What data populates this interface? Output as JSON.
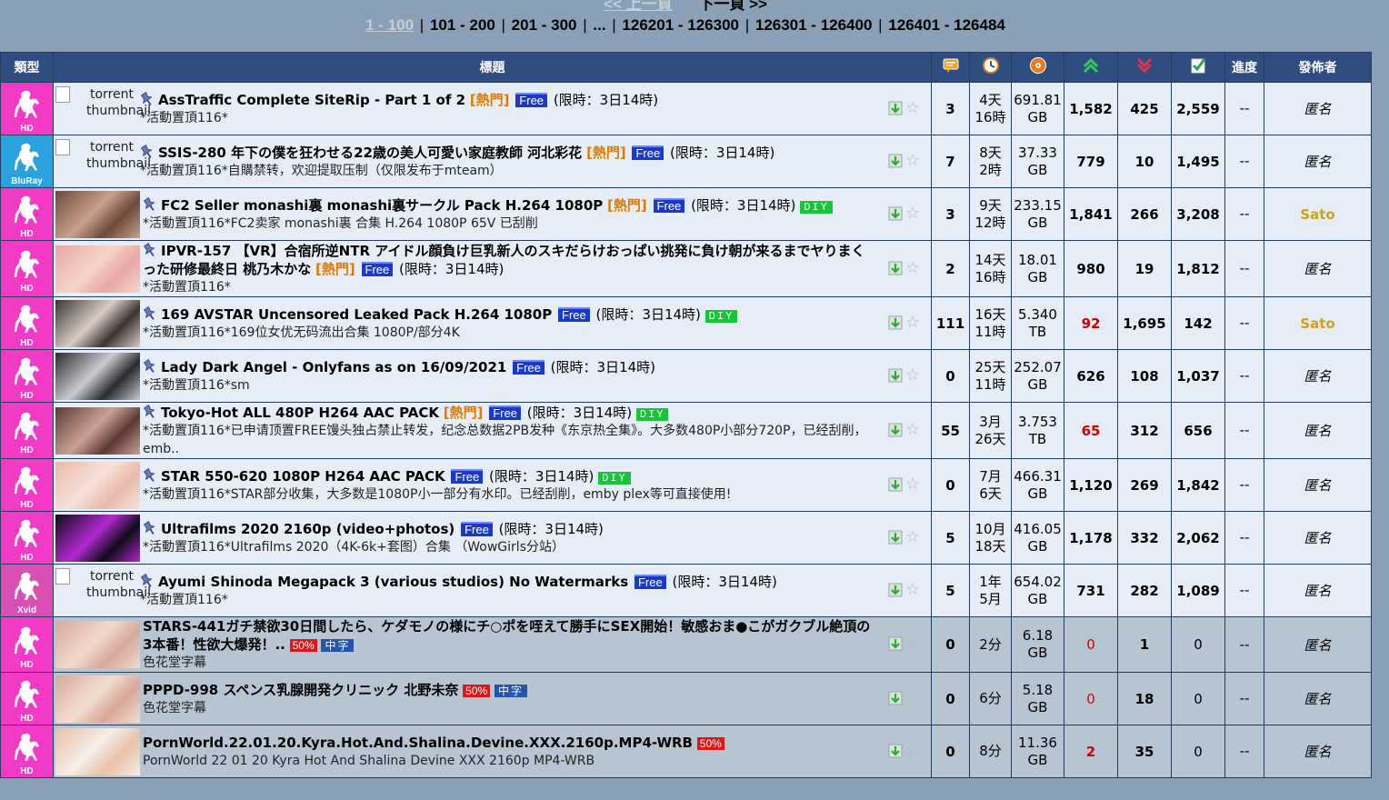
{
  "pager": {
    "prev": "<< 上一頁",
    "next": "下一頁 >>",
    "current": "1 - 100",
    "pages": [
      "101 - 200",
      "201 - 300",
      "...",
      "126201 - 126300",
      "126301 - 126400",
      "126401 - 126484"
    ]
  },
  "headers": {
    "category": "類型",
    "title": "標題",
    "progress": "進度",
    "uploader": "發佈者",
    "icons": [
      "comments-icon",
      "time-icon",
      "size-icon",
      "seeders-icon",
      "leechers-icon",
      "completed-icon"
    ]
  },
  "labels": {
    "hot": "[熱門]",
    "free": "Free",
    "diy": "DIY",
    "half": "50%",
    "zh": "中字",
    "limit": "(限時：3日14時)",
    "thumb_alt": "torrent thumbnail"
  },
  "rows": [
    {
      "cat": "HD",
      "cat_color": "#f33ac6",
      "thumb": "text",
      "thumb_colors": [],
      "title": "AssTraffic Complete SiteRip - Part 1 of 2",
      "hot": true,
      "free": true,
      "limit": true,
      "diy": false,
      "half": false,
      "zh": false,
      "sub": "*活動置頂116*",
      "comments": "3",
      "time1": "4天",
      "time2": "16時",
      "size1": "691.81",
      "size2": "GB",
      "seeders": "1,582",
      "seeders_red": false,
      "leechers": "425",
      "completed": "2,559",
      "progress": "--",
      "uploader": "匿名",
      "sato": false,
      "bg": "r",
      "height": 58
    },
    {
      "cat": "BluRay",
      "cat_color": "#2ba2e0",
      "thumb": "text",
      "thumb_colors": [],
      "title": "SSIS-280 年下の僕を狂わせる22歳の美人可愛い家庭教師 河北彩花",
      "hot": true,
      "free": true,
      "limit": true,
      "diy": false,
      "half": false,
      "zh": false,
      "sub": "*活動置頂116*自購禁转，欢迎提取压制（仅限发布于mteam）",
      "comments": "7",
      "time1": "8天",
      "time2": "2時",
      "size1": "37.33",
      "size2": "GB",
      "seeders": "779",
      "seeders_red": false,
      "leechers": "10",
      "completed": "1,495",
      "progress": "--",
      "uploader": "匿名",
      "sato": false,
      "bg": "r",
      "height": 58
    },
    {
      "cat": "HD",
      "cat_color": "#f33ac6",
      "thumb": "img",
      "thumb_colors": [
        "#6b4a3c",
        "#c9a08c"
      ],
      "title": "FC2 Seller monashi裏 monashi裏サークル Pack H.264 1080P",
      "hot": true,
      "free": true,
      "limit": true,
      "diy": true,
      "half": false,
      "zh": false,
      "sub": "*活動置頂116*FC2卖家 monashi裏 合集 H.264 1080P 65V 已刮削",
      "comments": "3",
      "time1": "9天",
      "time2": "12時",
      "size1": "233.15",
      "size2": "GB",
      "seeders": "1,841",
      "seeders_red": false,
      "leechers": "266",
      "completed": "3,208",
      "progress": "--",
      "uploader": "Sato",
      "sato": true,
      "bg": "r",
      "height": 58
    },
    {
      "cat": "HD",
      "cat_color": "#f33ac6",
      "thumb": "img",
      "thumb_colors": [
        "#e9a8a4",
        "#f3d5cc"
      ],
      "title": "IPVR-157 【VR】合宿所逆NTR アイドル顔負け巨乳新人のスキだらけおっぱい挑発に負け朝が来るまでヤりまくった研修最終日 桃乃木かな",
      "hot": true,
      "free": true,
      "limit": true,
      "diy": false,
      "half": false,
      "zh": false,
      "sub": "*活動置頂116*",
      "comments": "2",
      "time1": "14天",
      "time2": "16時",
      "size1": "18.01",
      "size2": "GB",
      "seeders": "980",
      "seeders_red": false,
      "leechers": "19",
      "completed": "1,812",
      "progress": "--",
      "uploader": "匿名",
      "sato": false,
      "bg": "r",
      "height": 62
    },
    {
      "cat": "HD",
      "cat_color": "#f33ac6",
      "thumb": "img",
      "thumb_colors": [
        "#3b3430",
        "#d8cdc5"
      ],
      "title": "169 AVSTAR Uncensored Leaked Pack H.264 1080P",
      "hot": false,
      "free": true,
      "limit": true,
      "diy": true,
      "half": false,
      "zh": false,
      "sub": "*活動置頂116*169位女优无码流出合集 1080P/部分4K",
      "comments": "111",
      "time1": "16天",
      "time2": "11時",
      "size1": "5.340",
      "size2": "TB",
      "seeders": "92",
      "seeders_red": true,
      "leechers": "1,695",
      "completed": "142",
      "progress": "--",
      "uploader": "Sato",
      "sato": true,
      "bg": "r",
      "height": 58
    },
    {
      "cat": "HD",
      "cat_color": "#f33ac6",
      "thumb": "img",
      "thumb_colors": [
        "#2a2a2e",
        "#c9c9d0"
      ],
      "title": "Lady Dark Angel - Onlyfans as on 16/09/2021",
      "hot": false,
      "free": true,
      "limit": true,
      "diy": false,
      "half": false,
      "zh": false,
      "sub": "*活動置頂116*sm",
      "comments": "0",
      "time1": "25天",
      "time2": "11時",
      "size1": "252.07",
      "size2": "GB",
      "seeders": "626",
      "seeders_red": false,
      "leechers": "108",
      "completed": "1,037",
      "progress": "--",
      "uploader": "匿名",
      "sato": false,
      "bg": "r",
      "height": 58
    },
    {
      "cat": "HD",
      "cat_color": "#f33ac6",
      "thumb": "img",
      "thumb_colors": [
        "#5a3a34",
        "#caa196"
      ],
      "title": "Tokyo-Hot ALL 480P H264 AAC PACK",
      "hot": true,
      "free": true,
      "limit": true,
      "diy": true,
      "half": false,
      "zh": false,
      "sub": "*活動置頂116*已申请顶置FREE馒头独占禁止转发，纪念总数据2PB发种《东京热全集》。大多数480P小部分720P，已经刮削，emb..",
      "comments": "55",
      "time1": "3月",
      "time2": "26天",
      "size1": "3.753",
      "size2": "TB",
      "seeders": "65",
      "seeders_red": true,
      "leechers": "312",
      "completed": "656",
      "progress": "--",
      "uploader": "匿名",
      "sato": false,
      "bg": "r",
      "height": 62
    },
    {
      "cat": "HD",
      "cat_color": "#f33ac6",
      "thumb": "img",
      "thumb_colors": [
        "#e8b9a8",
        "#f6e3da"
      ],
      "title": "STAR 550-620 1080P H264 AAC PACK",
      "hot": false,
      "free": true,
      "limit": true,
      "diy": true,
      "half": false,
      "zh": false,
      "sub": "*活動置頂116*STAR部分收集，大多数是1080P小一部分有水印。已经刮削，emby plex等可直接使用!",
      "comments": "0",
      "time1": "7月",
      "time2": "6天",
      "size1": "466.31",
      "size2": "GB",
      "seeders": "1,120",
      "seeders_red": false,
      "leechers": "269",
      "completed": "1,842",
      "progress": "--",
      "uploader": "匿名",
      "sato": false,
      "bg": "r",
      "height": 58
    },
    {
      "cat": "HD",
      "cat_color": "#f33ac6",
      "thumb": "img",
      "thumb_colors": [
        "#0f0b18",
        "#b02ad0"
      ],
      "title": "Ultrafilms 2020 2160p (video+photos)",
      "hot": false,
      "free": true,
      "limit": true,
      "diy": false,
      "half": false,
      "zh": false,
      "sub": "*活動置頂116*Ultrafilms 2020（4K-6k+套图）合集 （WowGirls分站）",
      "comments": "5",
      "time1": "10月",
      "time2": "18天",
      "size1": "416.05",
      "size2": "GB",
      "seeders": "1,178",
      "seeders_red": false,
      "leechers": "332",
      "completed": "2,062",
      "progress": "--",
      "uploader": "匿名",
      "sato": false,
      "bg": "r",
      "height": 58
    },
    {
      "cat": "Xvid",
      "cat_color": "#d94fb4",
      "thumb": "text",
      "thumb_colors": [],
      "title": "Ayumi Shinoda Megapack 3 (various studios) No Watermarks",
      "hot": false,
      "free": true,
      "limit": true,
      "diy": false,
      "half": false,
      "zh": false,
      "sub": "*活動置頂116*",
      "comments": "5",
      "time1": "1年",
      "time2": "5月",
      "size1": "654.02",
      "size2": "GB",
      "seeders": "731",
      "seeders_red": false,
      "leechers": "282",
      "completed": "1,089",
      "progress": "--",
      "uploader": "匿名",
      "sato": false,
      "bg": "r",
      "height": 58
    },
    {
      "cat": "HD",
      "cat_color": "#f33ac6",
      "thumb": "img",
      "thumb_colors": [
        "#d7a99a",
        "#f1d9cf"
      ],
      "title": "STARS-441ガチ禁欲30日間したら、ケダモノの様にチ○ポを咥えて勝手にSEX開始！敏感おま●こがガクブル絶頂の3本番！性欲大爆発！..",
      "hot": false,
      "free": false,
      "limit": false,
      "diy": false,
      "half": true,
      "zh": true,
      "sub": "色花堂字幕",
      "comments": "0",
      "time1": "2分",
      "time2": "",
      "size1": "6.18",
      "size2": "GB",
      "seeders": "0",
      "seeders_red": true,
      "leechers": "1",
      "completed": "0",
      "progress": "--",
      "uploader": "匿名",
      "sato": false,
      "bg": "g",
      "height": 58
    },
    {
      "cat": "HD",
      "cat_color": "#f33ac6",
      "thumb": "img",
      "thumb_colors": [
        "#d8a898",
        "#f3ddd3"
      ],
      "title": "PPPD-998 スペンス乳腺開発クリニック 北野未奈",
      "hot": false,
      "free": false,
      "limit": false,
      "diy": false,
      "half": true,
      "zh": true,
      "sub": "色花堂字幕",
      "comments": "0",
      "time1": "6分",
      "time2": "",
      "size1": "5.18",
      "size2": "GB",
      "seeders": "0",
      "seeders_red": true,
      "leechers": "18",
      "completed": "0",
      "progress": "--",
      "uploader": "匿名",
      "sato": false,
      "bg": "g",
      "height": 58
    },
    {
      "cat": "HD",
      "cat_color": "#f33ac6",
      "thumb": "img",
      "thumb_colors": [
        "#e7c1a6",
        "#f7eee8"
      ],
      "title": "PornWorld.22.01.20.Kyra.Hot.And.Shalina.Devine.XXX.2160p.MP4-WRB",
      "hot": false,
      "free": false,
      "limit": false,
      "diy": false,
      "half": true,
      "zh": false,
      "sub": "PornWorld 22 01 20 Kyra Hot And Shalina Devine XXX 2160p MP4-WRB",
      "comments": "0",
      "time1": "8分",
      "time2": "",
      "size1": "11.36",
      "size2": "GB",
      "seeders": "2",
      "seeders_red": true,
      "leechers": "35",
      "completed": "0",
      "progress": "--",
      "uploader": "匿名",
      "sato": false,
      "bg": "g",
      "height": 58
    }
  ]
}
